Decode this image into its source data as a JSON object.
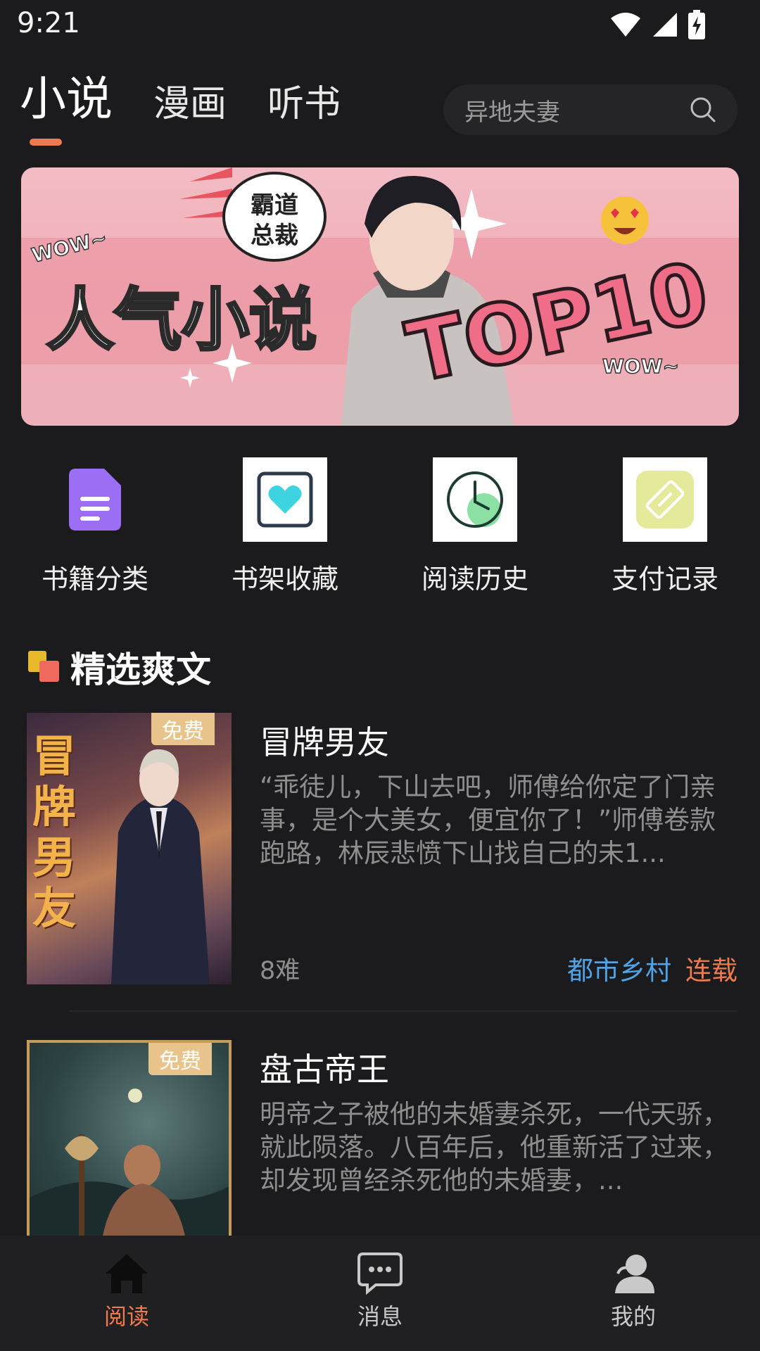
{
  "status_bar": {
    "time": "9:21"
  },
  "top_tabs": [
    {
      "label": "小说",
      "active": true
    },
    {
      "label": "漫画",
      "active": false
    },
    {
      "label": "听书",
      "active": false
    }
  ],
  "search": {
    "placeholder": "异地夫妻"
  },
  "banner": {
    "wow_left": "WOW~",
    "bubble_line1": "霸道",
    "bubble_line2": "总裁",
    "headline": "人气小说",
    "top": "TOP10",
    "wow_right": "WOW~"
  },
  "quick_entries": [
    {
      "label": "书籍分类",
      "icon": "document-icon"
    },
    {
      "label": "书架收藏",
      "icon": "heart-frame-icon"
    },
    {
      "label": "阅读历史",
      "icon": "clock-icon"
    },
    {
      "label": "支付记录",
      "icon": "ticket-icon"
    }
  ],
  "section": {
    "title": "精选爽文"
  },
  "books": [
    {
      "title": "冒牌男友",
      "badge": "免费",
      "cover_text": "冒牌男友",
      "description": "“乖徒儿，下山去吧，师傅给你定了门亲事，是个大美女，便宜你了！”师傅卷款跑路，林辰悲愤下山找自己的未1...",
      "author": "8难",
      "genre": "都市乡村",
      "status": "连载"
    },
    {
      "title": "盘古帝王",
      "badge": "免费",
      "description": "明帝之子被他的未婚妻杀死，一代天骄，就此陨落。八百年后，他重新活了过来，却发现曾经杀死他的未婚妻，..."
    }
  ],
  "bottom_nav": [
    {
      "label": "阅读",
      "icon": "home-icon",
      "active": true
    },
    {
      "label": "消息",
      "icon": "message-icon",
      "active": false
    },
    {
      "label": "我的",
      "icon": "profile-icon",
      "active": false
    }
  ],
  "colors": {
    "accent": "#f07a4d",
    "genre": "#4fa3e6",
    "background": "#1b1b1d",
    "badge": "#e8c48c"
  }
}
